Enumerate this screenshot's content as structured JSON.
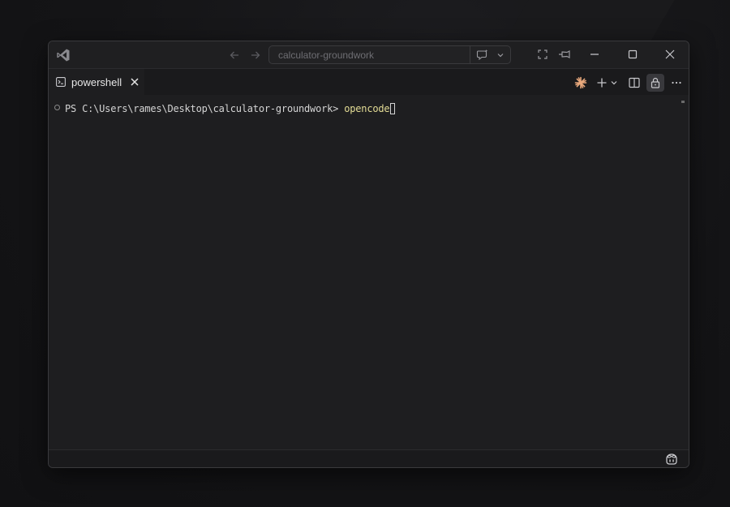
{
  "titlebar": {
    "search_text": "calculator-groundwork"
  },
  "tabs": [
    {
      "label": "powershell",
      "active": true
    }
  ],
  "terminal": {
    "prompt": "PS C:\\Users\\rames\\Desktop\\calculator-groundwork> ",
    "command": "opencode"
  },
  "icons": {
    "app": "vscode-icon",
    "back": "arrow-left-icon",
    "forward": "arrow-right-icon",
    "chat": "chat-icon",
    "chat_dropdown": "chevron-down-icon",
    "layout": "fullscreen-icon",
    "pin": "pin-icon",
    "minimize": "minimize-icon",
    "maximize": "maximize-icon",
    "close": "close-icon",
    "terminal": "terminal-icon",
    "tab_close": "close-icon",
    "spark": "spark-icon",
    "add": "plus-icon",
    "split": "split-icon",
    "lock": "lock-icon",
    "more": "more-icon",
    "copilot": "copilot-icon"
  },
  "colors": {
    "background": "#1e1e20",
    "text": "#d4d4d4",
    "command": "#e3dc95",
    "spark": "#e8a87c"
  }
}
